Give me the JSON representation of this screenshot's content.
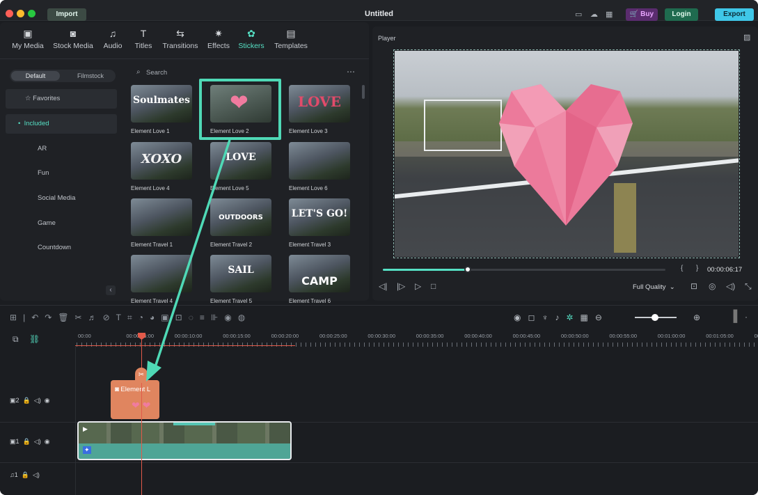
{
  "titlebar": {
    "import_label": "Import",
    "title": "Untitled",
    "buy_label": "Buy",
    "login_label": "Login",
    "export_label": "Export"
  },
  "media_tabs": [
    {
      "label": "My Media",
      "icon": "image-icon"
    },
    {
      "label": "Stock Media",
      "icon": "cloud-icon"
    },
    {
      "label": "Audio",
      "icon": "music-icon"
    },
    {
      "label": "Titles",
      "icon": "text-icon"
    },
    {
      "label": "Transitions",
      "icon": "transition-icon"
    },
    {
      "label": "Effects",
      "icon": "effects-icon"
    },
    {
      "label": "Stickers",
      "icon": "sticker-icon"
    },
    {
      "label": "Templates",
      "icon": "template-icon"
    }
  ],
  "library": {
    "default_tab": "Default",
    "filmstock_tab": "Filmstock",
    "search_placeholder": "Search"
  },
  "sidebar": [
    {
      "label": "Favorites"
    },
    {
      "label": "Included"
    },
    {
      "label": "AR"
    },
    {
      "label": "Fun"
    },
    {
      "label": "Social Media"
    },
    {
      "label": "Game"
    },
    {
      "label": "Countdown"
    }
  ],
  "stickers": [
    {
      "name": "Element Love 1",
      "art": "Soulmates"
    },
    {
      "name": "Element Love 2",
      "art": ""
    },
    {
      "name": "Element Love 3",
      "art": "LOVE"
    },
    {
      "name": "Element Love 4",
      "art": "XOXO"
    },
    {
      "name": "Element Love 5",
      "art": "LOVE"
    },
    {
      "name": "Element Love 6",
      "art": ""
    },
    {
      "name": "Element Travel 1",
      "art": ""
    },
    {
      "name": "Element Travel 2",
      "art": "OUTDOORS"
    },
    {
      "name": "Element Travel 3",
      "art": "LET'S GO!"
    },
    {
      "name": "Element Travel 4",
      "art": ""
    },
    {
      "name": "Element Travel 5",
      "art": "SAIL"
    },
    {
      "name": "Element Travel 6",
      "art": "CAMP"
    }
  ],
  "player": {
    "label": "Player",
    "timecode": "00:00:06:17",
    "quality": "Full Quality",
    "progress": 0.3
  },
  "ruler": [
    "00:00",
    "00:00:05:00",
    "00:00:10:00",
    "00:00:15:00",
    "00:00:20:00",
    "00:00:25:00",
    "00:00:30:00",
    "00:00:35:00",
    "00:00:40:00",
    "00:00:45:00",
    "00:00:50:00",
    "00:00:55:00",
    "00:01:00:00",
    "00:01:05:00",
    "00:01:1"
  ],
  "tracks": [
    {
      "label": "2",
      "type": "video"
    },
    {
      "label": "1",
      "type": "video"
    },
    {
      "label": "1",
      "type": "audio"
    }
  ],
  "sticker_clip": {
    "label": "Element L"
  },
  "colors": {
    "accent": "#56e0c4",
    "highlight": "#4fd9b6",
    "export": "#3fc7e8",
    "login": "#1f6b4f",
    "buy": "#5a2c6e",
    "clip_sticker": "#e0855f",
    "clip_video": "#4fa596",
    "playhead": "#e25a4a"
  }
}
